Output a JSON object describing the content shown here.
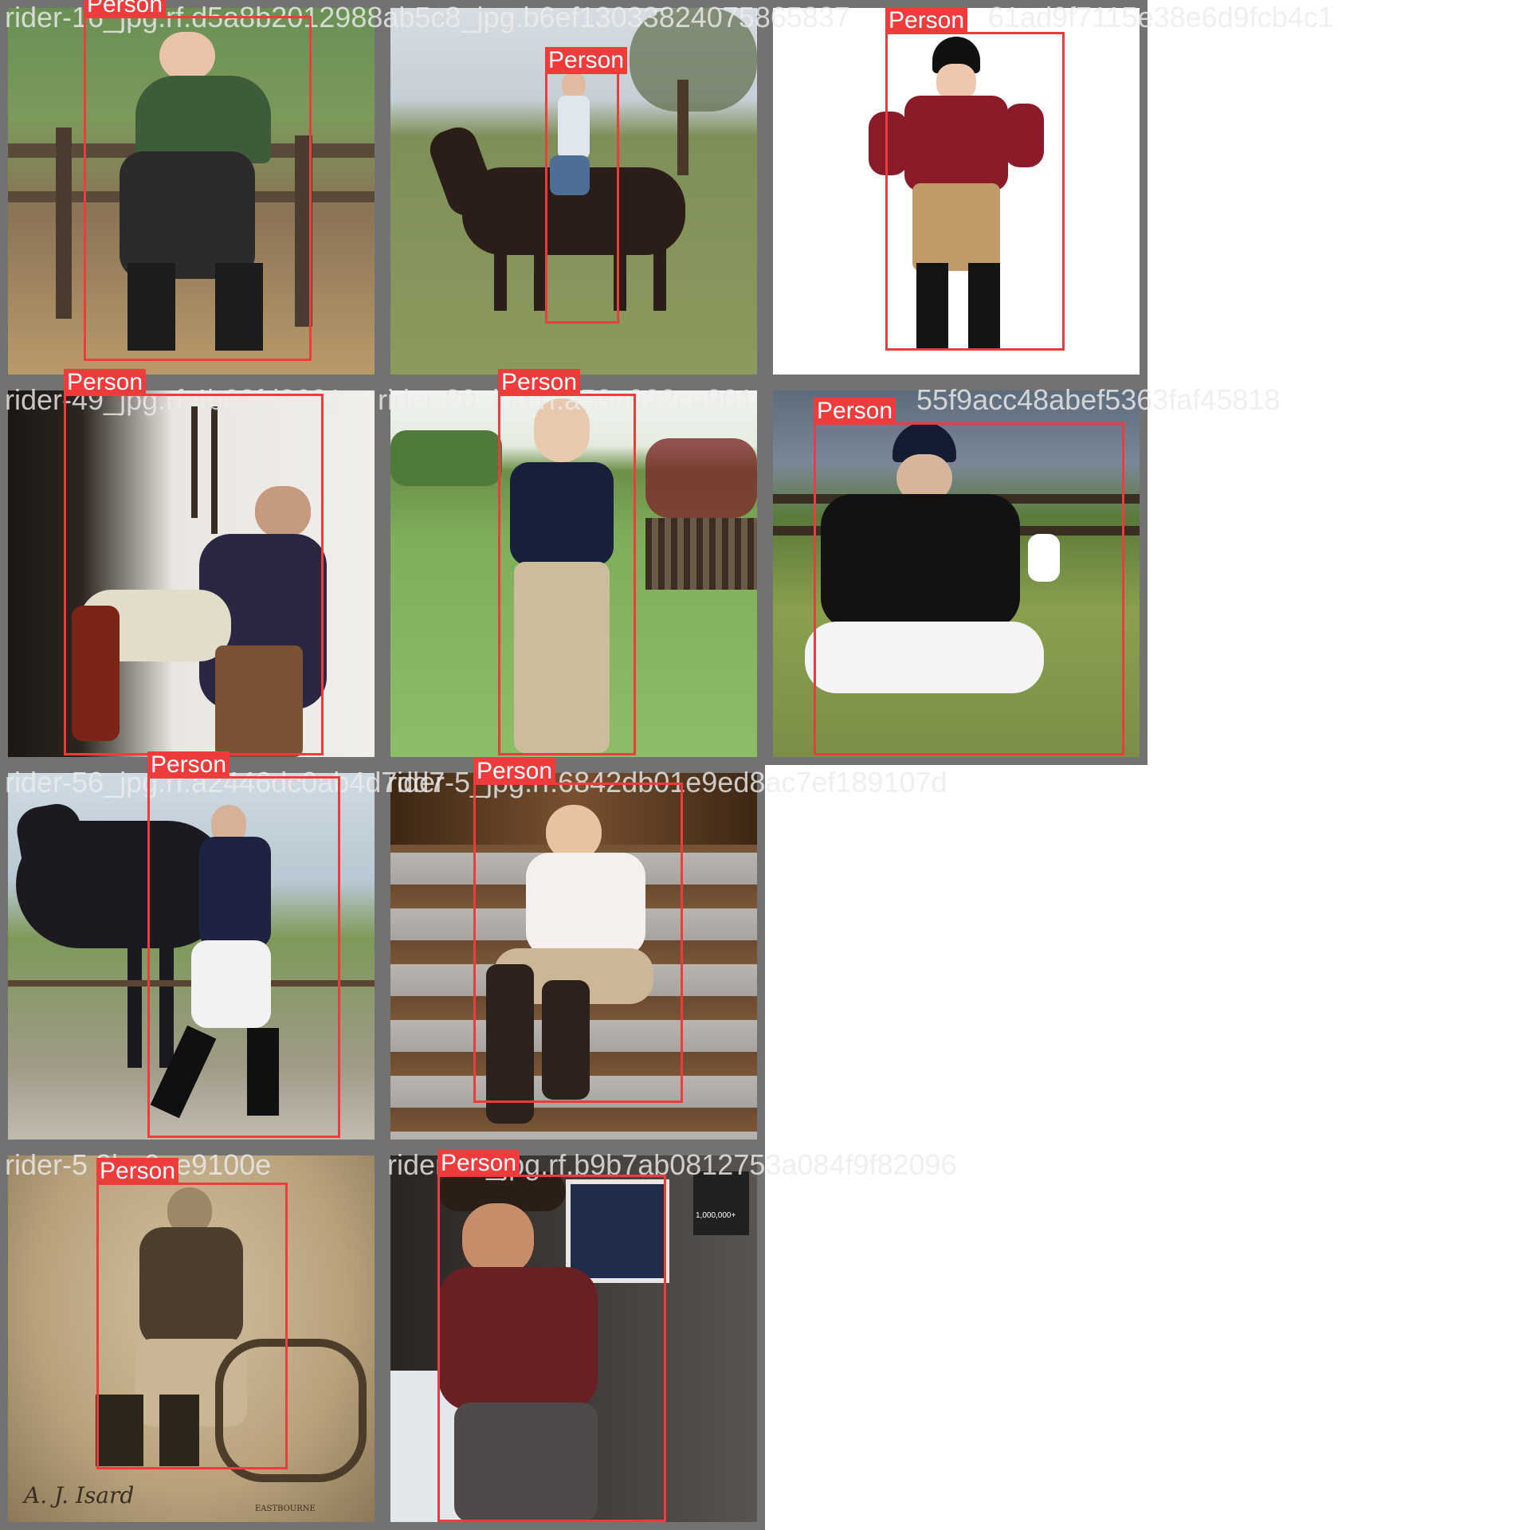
{
  "class_color": "#ee3b3b",
  "tiles": [
    {
      "filename": "rider-16_jpg.rf.d5a8b2012988ab5c8_jpg.b6ef13033824075865837",
      "detection": "Person"
    },
    {
      "filename": "",
      "detection": "Person"
    },
    {
      "filename": "61ad9f7115e38e6d9fcb4c1",
      "detection": "Person"
    },
    {
      "filename": "rider-49_jpg.rf.4b62fd2681",
      "detection": "Person"
    },
    {
      "filename": "rider-20_jpg.rf.a53e022ca901",
      "detection": "Person"
    },
    {
      "filename": "55f9acc48abef5363faf45818",
      "detection": "Person"
    },
    {
      "filename": "rider-56_jpg.rf.a2446dc0ab4d7dd7",
      "detection": "Person"
    },
    {
      "filename": "rider-5_jpg.rf.6842db01e9ed8ac7ef189107d",
      "detection": "Person"
    },
    {
      "filename": "rider-5 8ba6ae9100e",
      "detection": "Person"
    },
    {
      "filename": "rider-59_jpg.rf.b9b7ab0812753a084f9f82096",
      "detection": "Person"
    }
  ],
  "photo_text": {
    "signature": "A. J. Isard",
    "studio": "EASTBOURNE",
    "poster": "1,000,000+"
  }
}
